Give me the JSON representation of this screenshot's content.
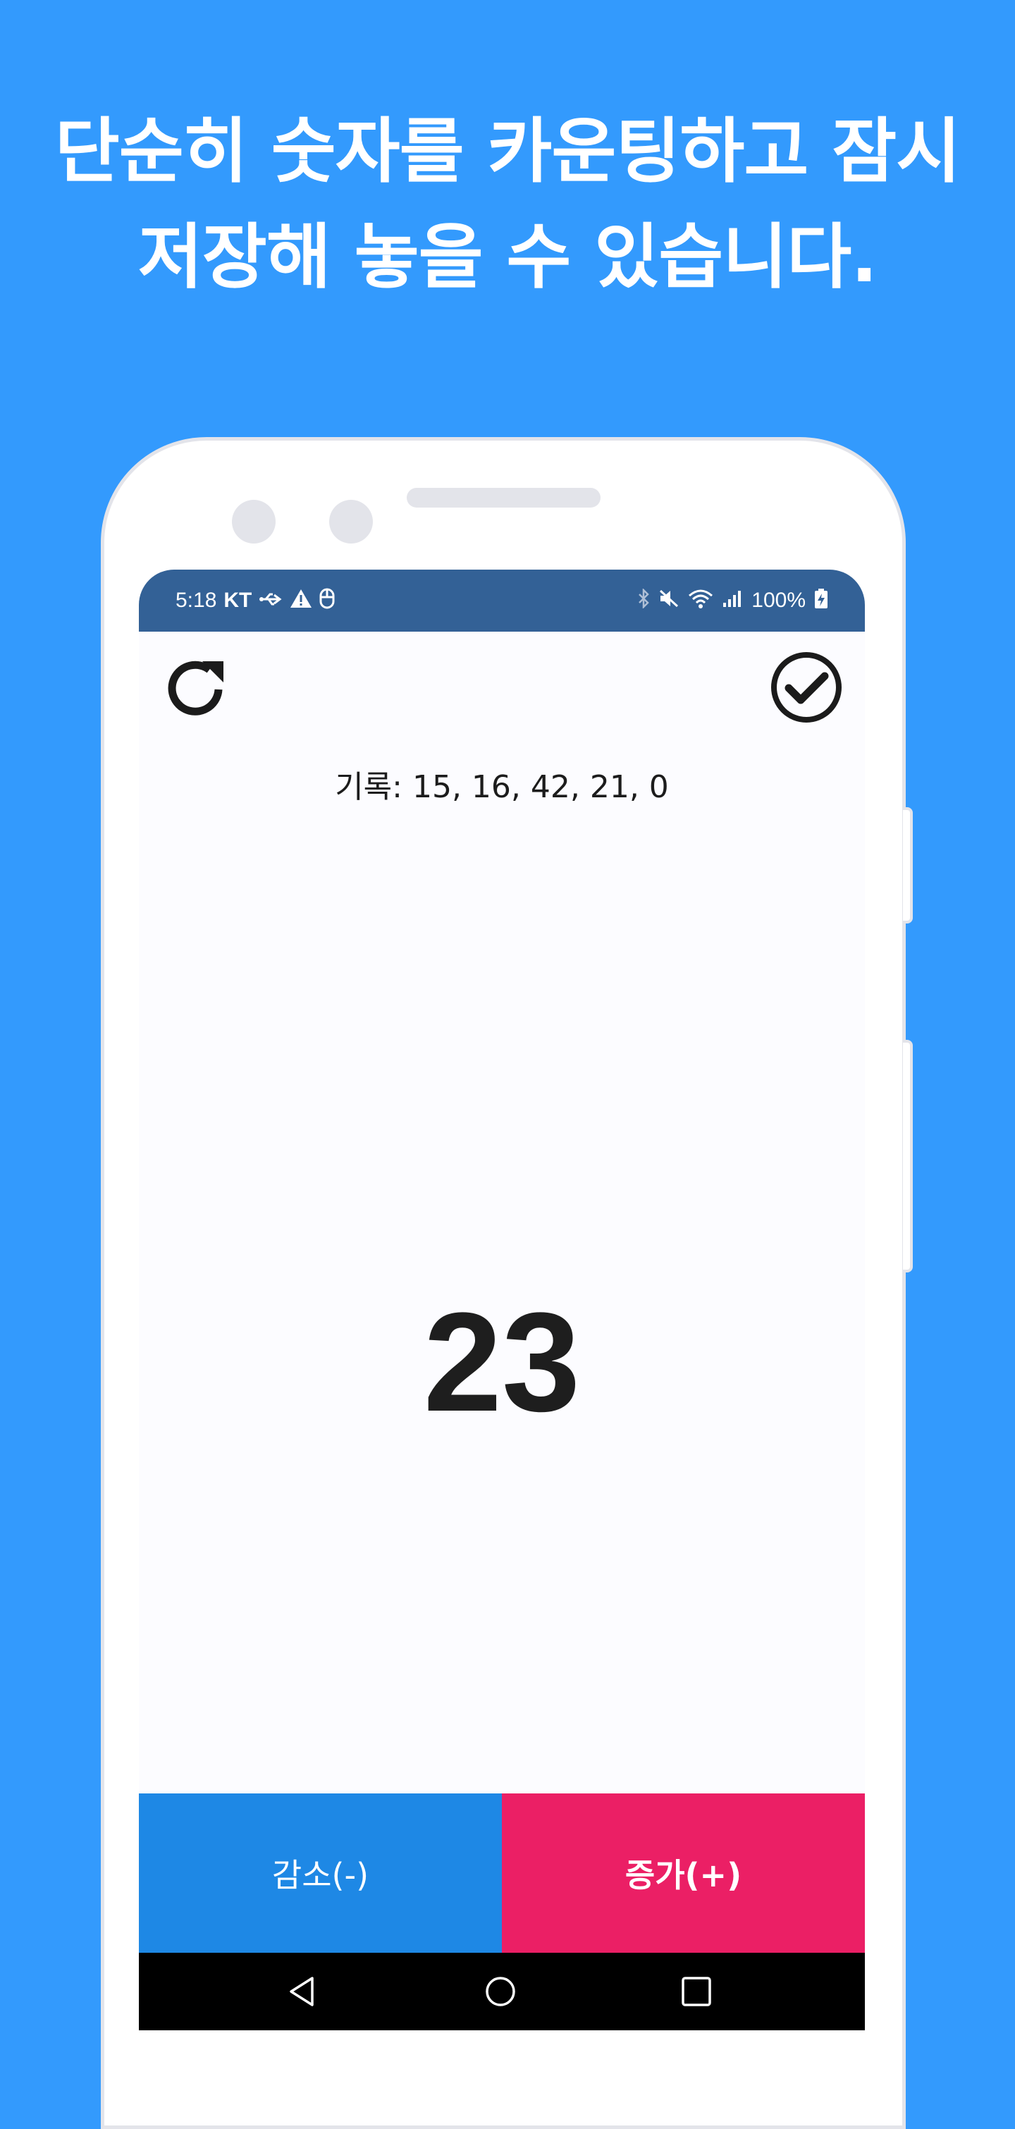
{
  "headline": {
    "line1": "단순히 숫자를 카운팅하고 잠시",
    "line2": "저장해 놓을 수 있습니다."
  },
  "status_bar": {
    "time": "5:18",
    "carrier": "KT",
    "battery": "100%",
    "left_icons": [
      "usb-icon",
      "warning-icon",
      "mouse-icon"
    ],
    "right_icons": [
      "bluetooth-icon",
      "mute-icon",
      "wifi-icon",
      "signal-icon",
      "battery-charging-icon"
    ]
  },
  "toolbar": {
    "icons": [
      "refresh-icon",
      "check-circle-icon"
    ]
  },
  "history": {
    "text": "기록: 15, 16, 42, 21, 0"
  },
  "counter": {
    "value": "23"
  },
  "buttons": {
    "decrease_label": "감소(-)",
    "increase_label": "증가(+)"
  },
  "colors": {
    "background": "#339afd",
    "status_bar": "#336196",
    "decrease": "#1e88e5",
    "increase": "#eb1f65"
  },
  "nav_bar": {
    "icons": [
      "back-icon",
      "home-icon",
      "recents-icon"
    ]
  }
}
